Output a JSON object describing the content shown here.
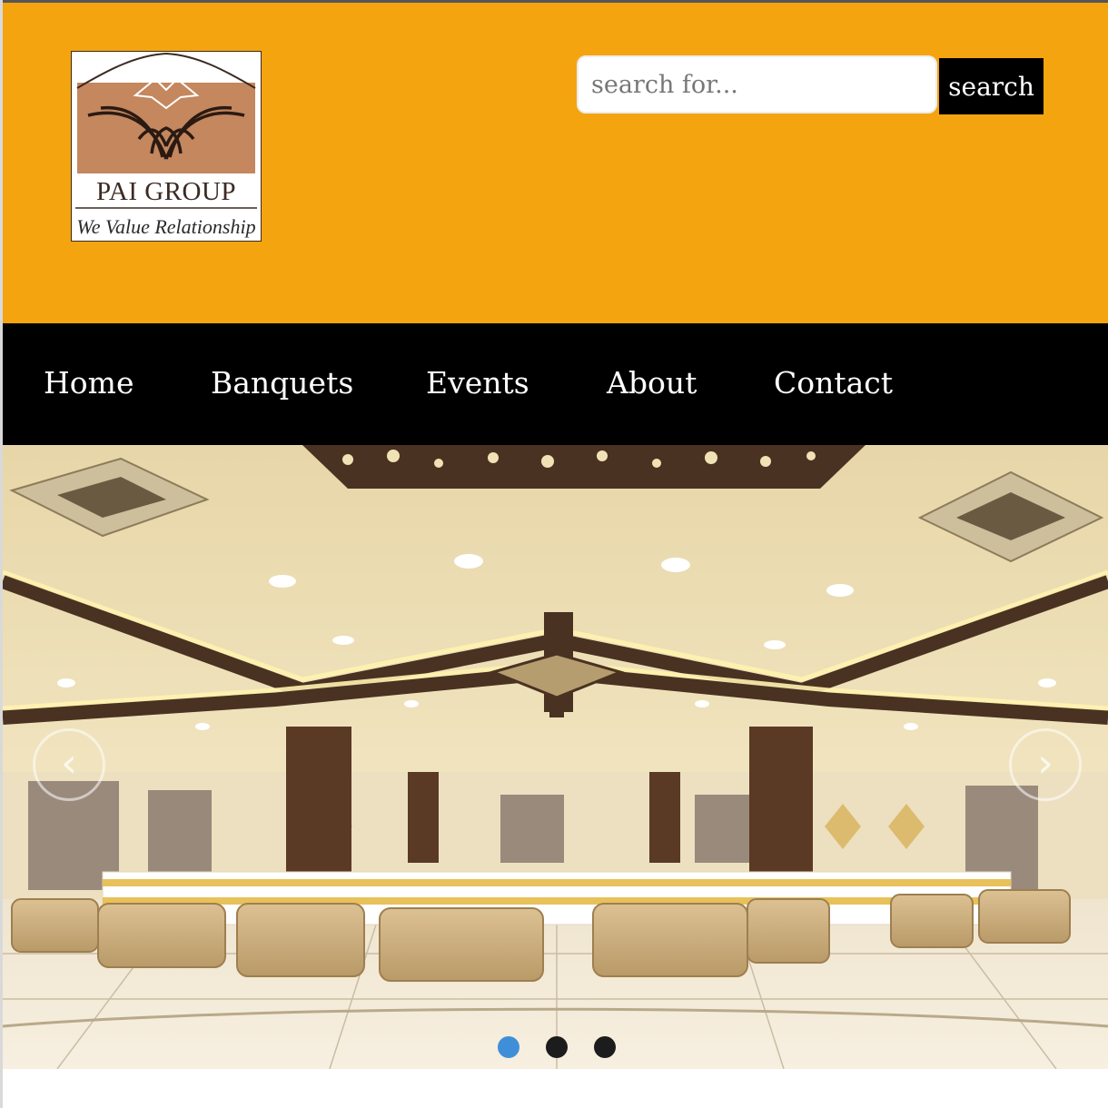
{
  "brand": {
    "logo_name": "PAI GROUP",
    "tagline": "We Value Relationship",
    "logo_icon": "pai-group-emblem"
  },
  "search": {
    "placeholder": "search for...",
    "value": "",
    "button_label": "search"
  },
  "nav": {
    "items": [
      {
        "label": "Home"
      },
      {
        "label": "Banquets"
      },
      {
        "label": "Events"
      },
      {
        "label": "About"
      },
      {
        "label": "Contact"
      }
    ]
  },
  "carousel": {
    "slide_subject": "banquet hall interior",
    "prev_icon": "chevron-left-icon",
    "next_icon": "chevron-right-icon",
    "prev_glyph": "‹",
    "next_glyph": "›",
    "slide_count": 3,
    "active_index": 0
  },
  "colors": {
    "header_bg": "#f4a40e",
    "nav_bg": "#000000",
    "nav_text": "#ffffff",
    "search_button_bg": "#000000",
    "dot_active": "#3f8fd8",
    "dot_inactive": "#1c1c1c",
    "logo_brown": "#c4875e"
  }
}
